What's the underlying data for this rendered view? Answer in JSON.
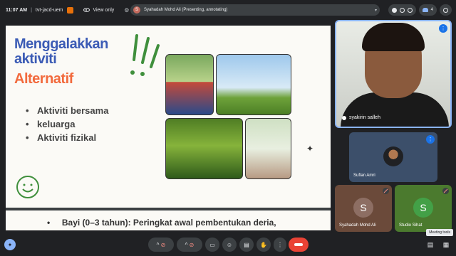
{
  "topbar": {
    "time": "11:07 AM",
    "separator": "|",
    "meeting_code": "tvt-jacd-uem",
    "view_only": "View only",
    "presenter_initial": "S",
    "presenter_text": "Syahadah Mohd Ali (Presenting, annotating)",
    "participant_count": "4"
  },
  "slide": {
    "title_line1": "Menggalakkan",
    "title_line2": "aktiviti",
    "title_line3": "Alternatif",
    "bullets": [
      "Aktiviti bersama",
      "keluarga",
      "Aktiviti fizikal"
    ],
    "footer": "Bayi (0–3 tahun): Peringkat awal pembentukan deria,",
    "sparkle": "✦"
  },
  "tiles": {
    "main_name": "syakirin salleh",
    "suf_name": "Suflan Amri",
    "syah_name": "Syahadah Mohd Ali",
    "syah_initial": "S",
    "studio_name": "Studio Sihat",
    "studio_initial": "S"
  },
  "bottom": {
    "tooltip": "Meeting tools"
  },
  "colors": {
    "accent": "#8ab4f8",
    "danger": "#ea4335",
    "title_blue": "#3b5bb5",
    "title_orange": "#f26a3d"
  }
}
